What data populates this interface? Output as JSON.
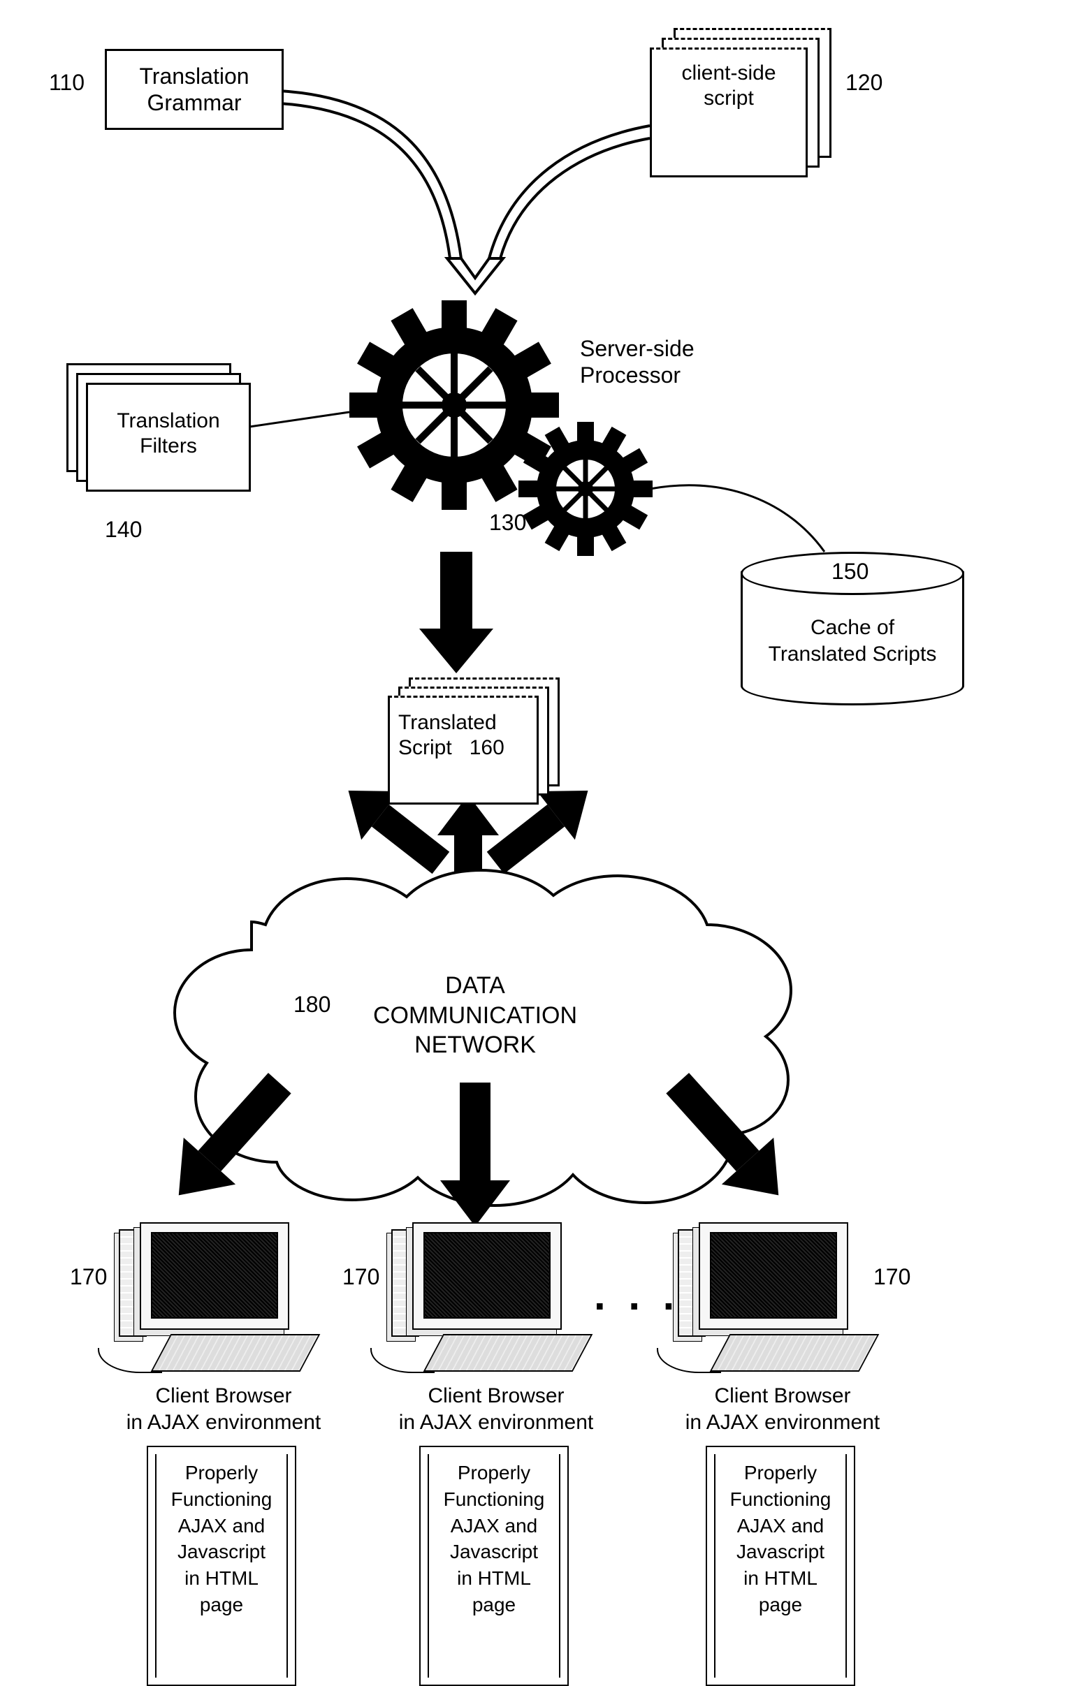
{
  "nodes": {
    "translation_grammar": {
      "ref": "110",
      "label": "Translation\nGrammar"
    },
    "client_side_script": {
      "ref": "120",
      "label": "client-side\nscript"
    },
    "server_processor": {
      "ref": "130",
      "label": "Server-side\nProcessor"
    },
    "translation_filters": {
      "ref": "140",
      "label": "Translation\nFilters"
    },
    "cache": {
      "ref": "150",
      "label": "Cache of\nTranslated Scripts"
    },
    "translated_script": {
      "ref": "160",
      "label": "Translated\nScript"
    },
    "client_browser": {
      "ref": "170",
      "caption": "Client Browser\nin AJAX environment",
      "page_text": "Properly\nFunctioning\nAJAX and\nJavascript\nin HTML\npage"
    },
    "network": {
      "ref": "180",
      "label": "DATA\nCOMMUNICATION\nNETWORK"
    }
  },
  "ellipsis": ". . ."
}
